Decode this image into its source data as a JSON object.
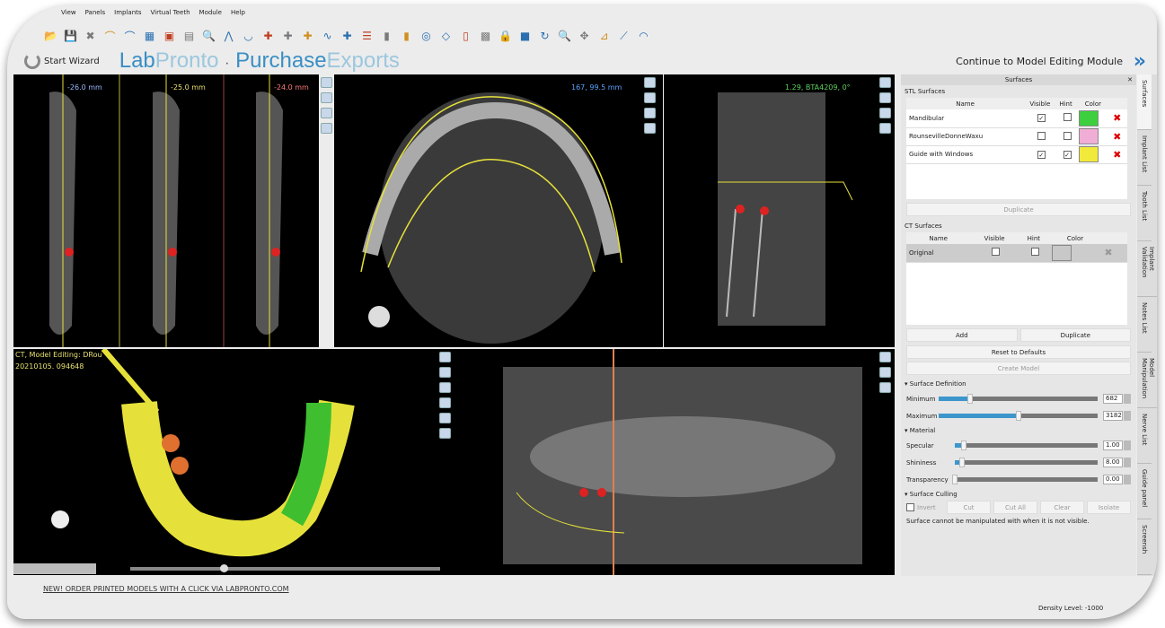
{
  "menu": [
    "View",
    "Panels",
    "Implants",
    "Virtual Teeth",
    "Module",
    "Help"
  ],
  "toolbar_icons": [
    "open-icon",
    "save-icon",
    "close-file-icon",
    "arch-icon",
    "arch2-icon",
    "grid-icon",
    "layers-icon",
    "tooth-chart-icon",
    "dicom-search-icon",
    "nerve-icon",
    "mandible-icon",
    "add-implant-icon",
    "add-sleeve-icon",
    "add-tooth-icon",
    "curve-icon",
    "pin-icon",
    "list-icon",
    "implant-icon",
    "abutment-icon",
    "guide-icon",
    "crown-icon",
    "sleeve-icon",
    "palette-icon",
    "lock-icon",
    "contrast-icon",
    "rotate-icon",
    "zoom-icon",
    "pan-icon",
    "measure-icon",
    "ruler-icon",
    "angle-icon"
  ],
  "wizard": {
    "start": "Start Wizard",
    "brand1": "Lab",
    "brand2": "Pronto",
    "sep": "·",
    "brand3": "Purchase",
    "brand4": "Exports",
    "continue": "Continue to Model Editing Module"
  },
  "viewports": {
    "cross1": "-26.0 mm",
    "cross2": "-25.0 mm",
    "cross3": "-24.0 mm",
    "axial": "167, 99.5 mm",
    "sagittal": "1.29, BTA4209, 0°",
    "model_line1": "CT, Model Editing: DRou",
    "model_line2": "20210105. 094648"
  },
  "panel": {
    "title": "Surfaces",
    "stl_label": "STL Surfaces",
    "headers": [
      "Name",
      "Visible",
      "Hint",
      "Color"
    ],
    "stl": [
      {
        "name": "Mandibular",
        "visible": true,
        "hint": false,
        "color": "#3ecf3e"
      },
      {
        "name": "RounsevilleDonneWaxu",
        "visible": false,
        "hint": false,
        "color": "#f0aed6"
      },
      {
        "name": "Guide with Windows",
        "visible": true,
        "hint": true,
        "color": "#f2ea3a"
      }
    ],
    "duplicate": "Duplicate",
    "ct_label": "CT Surfaces",
    "ct": [
      {
        "name": "Original",
        "visible": false,
        "hint": false,
        "color": "#c8c8c8"
      }
    ],
    "add": "Add",
    "duplicate2": "Duplicate",
    "reset": "Reset to Defaults",
    "create": "Create Model",
    "surface_def": "Surface Definition",
    "minimum": "Minimum",
    "min_val": "682",
    "min_frac": 0.2,
    "maximum": "Maximum",
    "max_val": "3182",
    "max_frac": 0.5,
    "material": "Material",
    "specular": "Specular",
    "spec_val": "1.00",
    "spec_frac": 0.06,
    "shininess": "Shininess",
    "shin_val": "8.00",
    "shin_frac": 0.05,
    "transparency": "Transparency",
    "trans_val": "0.00",
    "trans_frac": 0,
    "culling": "Surface Culling",
    "invert": "Invert",
    "cut": "Cut",
    "cutall": "Cut All",
    "clear": "Clear",
    "isolate": "Isolate",
    "note": "Surface cannot be manipulated with when it is not visible."
  },
  "side_tabs": [
    "Surfaces",
    "Implant List",
    "Tooth List",
    "Implant Validation",
    "Notes List",
    "Model Manipulation",
    "Nerve List",
    "Guide panel",
    "Screensh"
  ],
  "status": {
    "link": "NEW! ORDER PRINTED MODELS WITH A CLICK VIA LABPRONTO.COM",
    "density": "Density Level: -1000"
  }
}
